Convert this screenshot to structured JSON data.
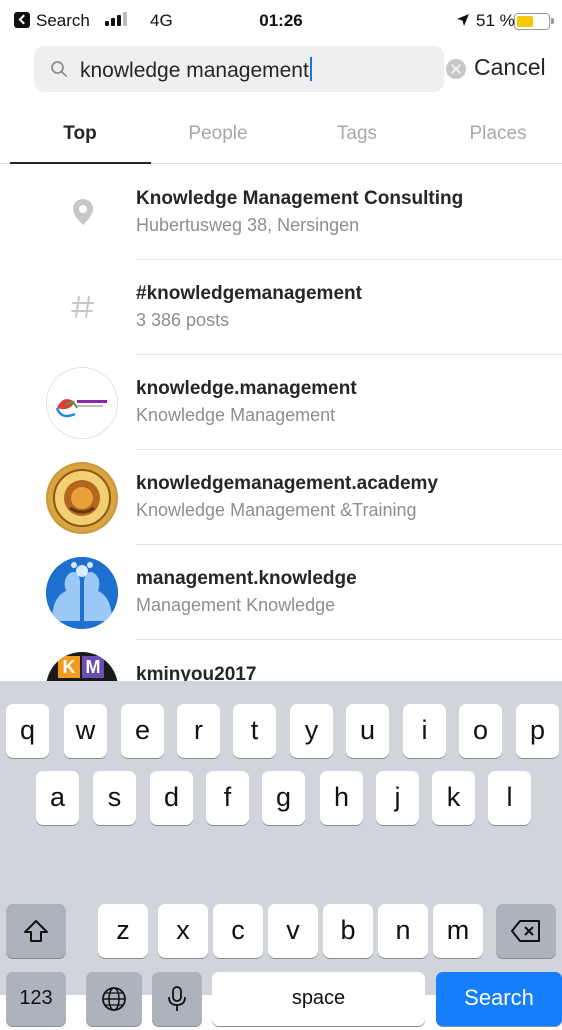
{
  "status_bar": {
    "back_label": "Search",
    "network": "4G",
    "time": "01:26",
    "battery_percent": "51 %",
    "battery_level": 0.51
  },
  "search": {
    "query": "knowledge management",
    "cancel_label": "Cancel"
  },
  "tabs": [
    "Top",
    "People",
    "Tags",
    "Places"
  ],
  "active_tab": "Top",
  "results": [
    {
      "icon": "location-pin-icon",
      "title": "Knowledge Management Consulting",
      "subtitle": "Hubertusweg 38, Nersingen"
    },
    {
      "icon": "hashtag-icon",
      "title": "#knowledgemanagement",
      "subtitle": "3 386 posts"
    },
    {
      "icon": "avatar",
      "title": "knowledge.management",
      "subtitle": "Knowledge Management"
    },
    {
      "icon": "avatar",
      "title": "knowledgemanagement.academy",
      "subtitle": "Knowledge Management &Training"
    },
    {
      "icon": "avatar",
      "title": "management.knowledge",
      "subtitle": "Management Knowledge"
    },
    {
      "icon": "avatar",
      "title": "kminyou2017",
      "subtitle": ""
    }
  ],
  "avatar_texts": {
    "km_logo": "KM"
  },
  "keyboard": {
    "row1": [
      "q",
      "w",
      "e",
      "r",
      "t",
      "y",
      "u",
      "i",
      "o",
      "p"
    ],
    "row2": [
      "a",
      "s",
      "d",
      "f",
      "g",
      "h",
      "j",
      "k",
      "l"
    ],
    "row3": [
      "z",
      "x",
      "c",
      "v",
      "b",
      "n",
      "m"
    ],
    "numbers_key": "123",
    "space_key": "space",
    "search_key": "Search"
  },
  "colors": {
    "accent_blue": "#147efb",
    "battery_yellow": "#f5c900",
    "muted_text": "#8e8e8e"
  }
}
